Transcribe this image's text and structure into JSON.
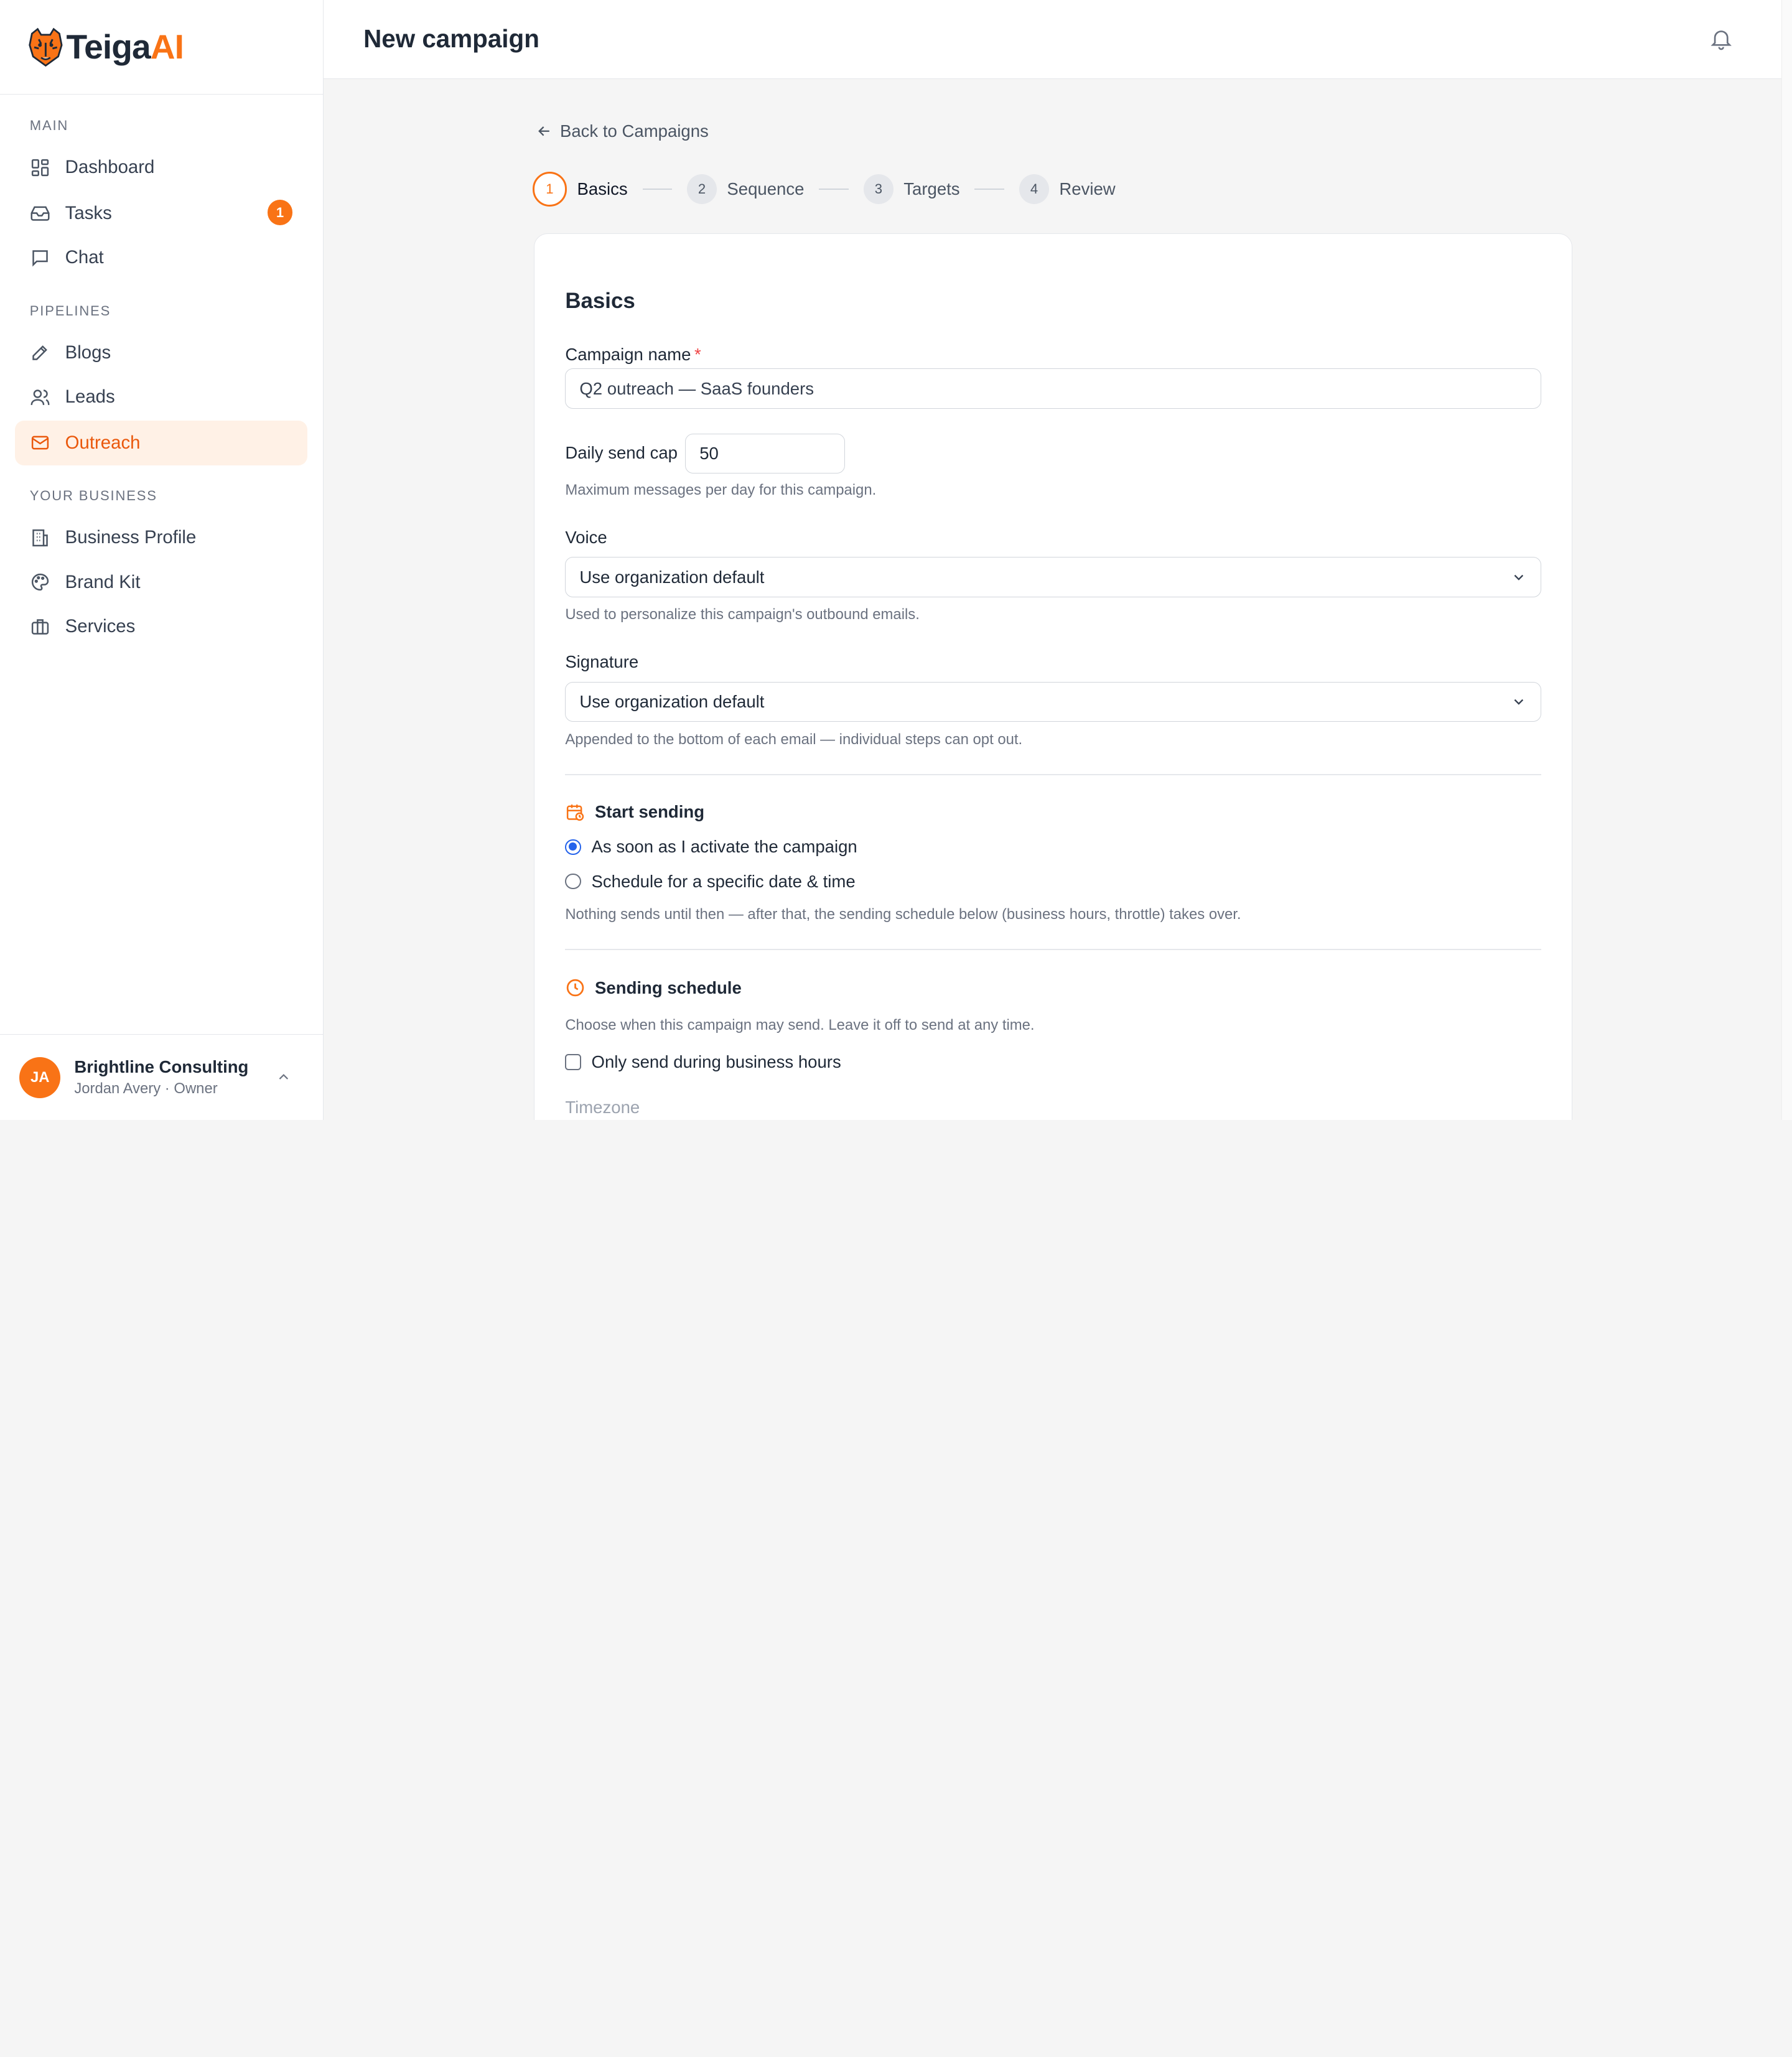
{
  "brand": {
    "name_part1": "Teiga",
    "name_part2": "AI",
    "primary": "#f97316"
  },
  "sidebar": {
    "sections": [
      {
        "label": "MAIN"
      },
      {
        "label": "PIPELINES"
      },
      {
        "label": "YOUR BUSINESS"
      }
    ],
    "items": [
      {
        "label": "Dashboard",
        "icon": "dashboard-icon"
      },
      {
        "label": "Tasks",
        "icon": "inbox-icon",
        "badge": "1"
      },
      {
        "label": "Chat",
        "icon": "chat-icon"
      },
      {
        "label": "Blogs",
        "icon": "pen-icon"
      },
      {
        "label": "Leads",
        "icon": "users-icon"
      },
      {
        "label": "Outreach",
        "icon": "mail-icon",
        "active": true
      },
      {
        "label": "Business Profile",
        "icon": "building-icon"
      },
      {
        "label": "Brand Kit",
        "icon": "palette-icon"
      },
      {
        "label": "Services",
        "icon": "briefcase-icon"
      }
    ],
    "user": {
      "initials": "JA",
      "org": "Brightline Consulting",
      "role": "Jordan Avery · Owner"
    }
  },
  "header": {
    "title": "New campaign"
  },
  "main": {
    "back_label": "Back to Campaigns",
    "steps": [
      {
        "num": "1",
        "label": "Basics"
      },
      {
        "num": "2",
        "label": "Sequence"
      },
      {
        "num": "3",
        "label": "Targets"
      },
      {
        "num": "4",
        "label": "Review"
      }
    ],
    "form": {
      "section_title": "Basics",
      "campaign_name_label": "Campaign name",
      "required_mark": "*",
      "campaign_name_value": "Q2 outreach — SaaS founders",
      "daily_cap_label": "Daily send cap",
      "daily_cap_value": "50",
      "daily_cap_help": "Maximum messages per day for this campaign.",
      "voice_label": "Voice",
      "voice_value": "Use organization default",
      "voice_help": "Used to personalize this campaign's outbound emails.",
      "signature_label": "Signature",
      "signature_value": "Use organization default",
      "signature_help": "Appended to the bottom of each email — individual steps can opt out.",
      "start_title": "Start sending",
      "start_option_1": "As soon as I activate the campaign",
      "start_option_2": "Schedule for a specific date & time",
      "start_help": "Nothing sends until then — after that, the sending schedule below (business hours, throttle) takes over.",
      "schedule_title": "Sending schedule",
      "schedule_help": "Choose when this campaign may send. Leave it off to send at any time.",
      "business_hours_label": "Only send during business hours",
      "timezone_label": "Timezone"
    }
  }
}
